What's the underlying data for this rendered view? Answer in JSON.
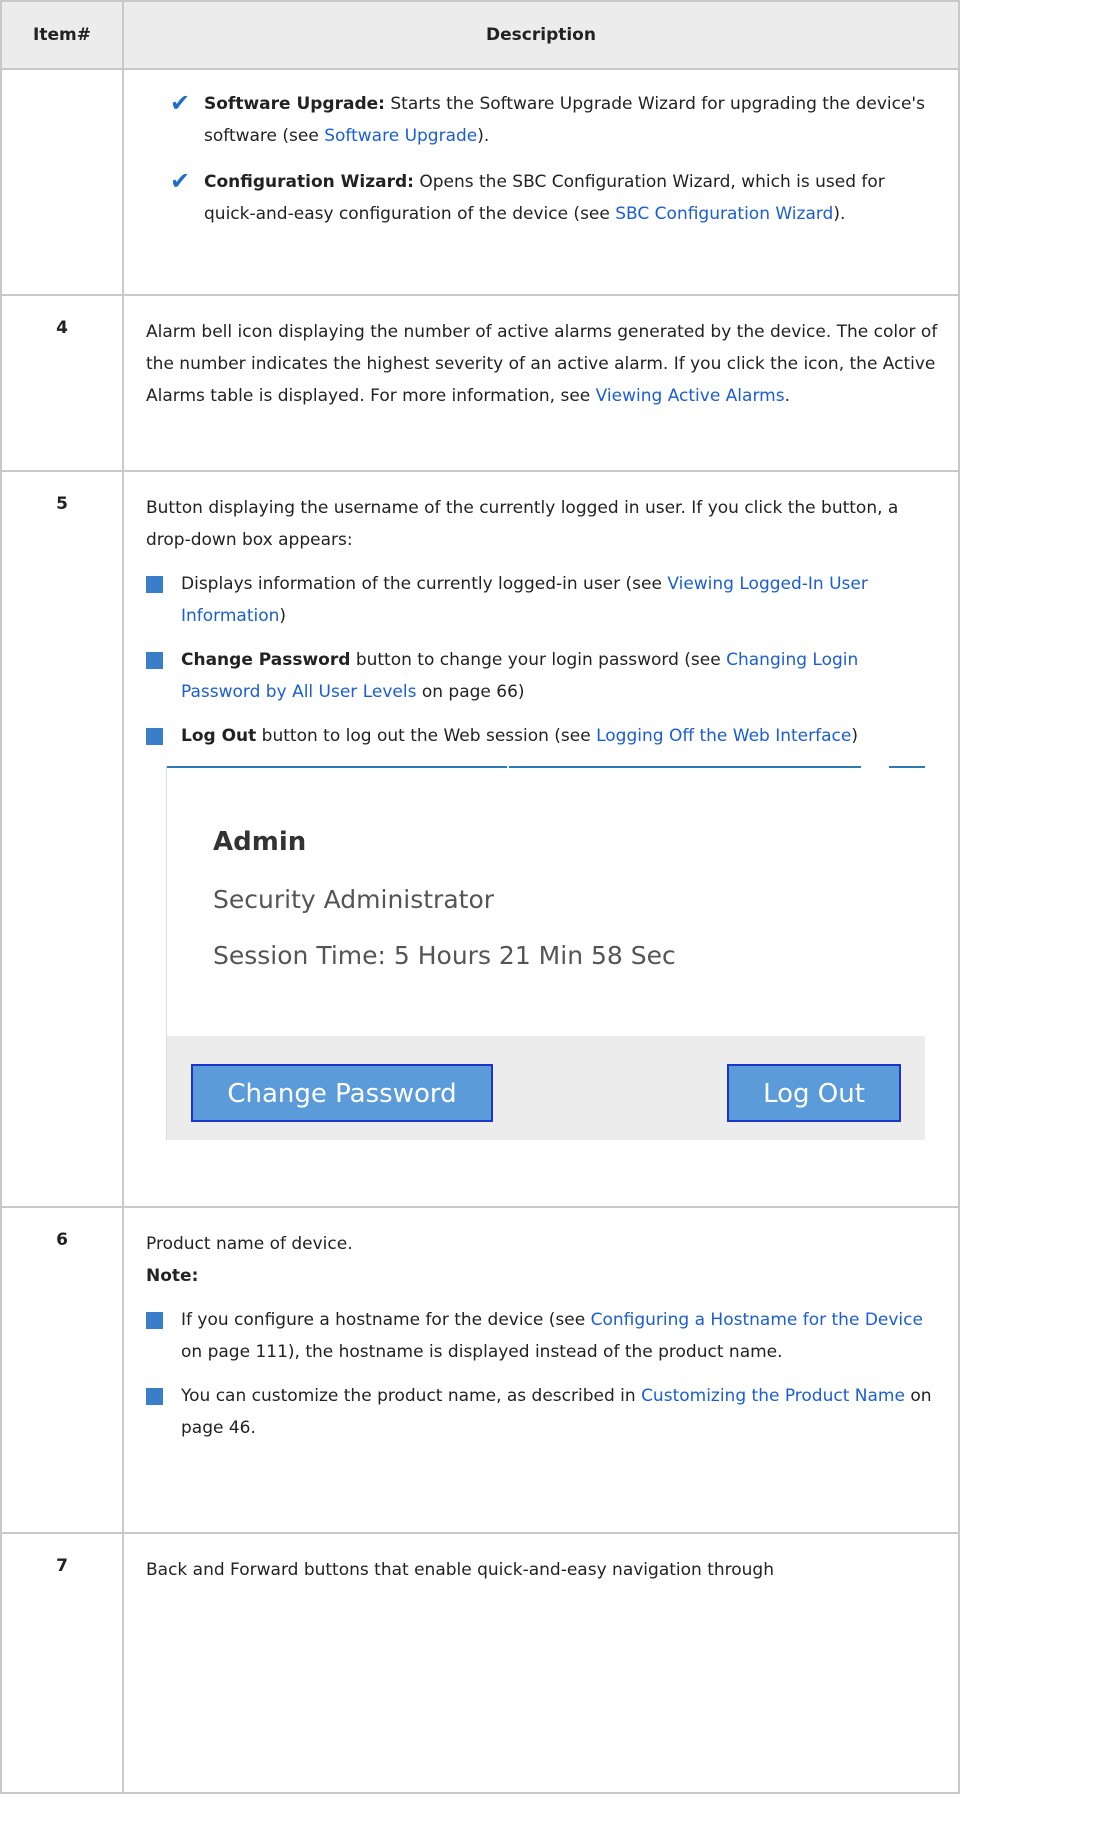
{
  "table": {
    "header": {
      "item": "Item#",
      "description": "Description"
    },
    "row_top": {
      "software_upgrade": {
        "bold": "Software Upgrade:",
        "text1": " Starts the Software Upgrade Wizard for upgrading the device's software (see ",
        "link": "Software Upgrade",
        "text2": ")."
      },
      "config_wizard": {
        "bold": "Configuration Wizard:",
        "text1": " Opens the SBC Configuration Wizard, which is used for quick-and-easy configuration of the device (see ",
        "link": "SBC Configuration Wizard",
        "text2": ")."
      }
    },
    "row4": {
      "number": "4",
      "text": "Alarm bell icon displaying the number of active alarms generated by the device. The color of the number indicates the highest severity of an active alarm. If you click the icon, the Active Alarms table is displayed. For more information, see ",
      "link": "Viewing Active Alarms",
      "text_end": "."
    },
    "row5": {
      "number": "5",
      "intro": "Button displaying the username of the currently logged in user. If you click the button, a drop-down box appears:",
      "b1": {
        "text1": "Displays information of the currently logged-in user (see ",
        "link": "Viewing Logged-In User Information",
        "text2": ")"
      },
      "b2": {
        "bold": "Change Password",
        "text1": " button to change your login password (see ",
        "link": "Changing Login Password by All User Levels",
        "text2": " on page 66)"
      },
      "b3": {
        "bold": "Log Out",
        "text1": " button to log out the Web session (see ",
        "link": "Logging Off the Web Interface",
        "text2": ")"
      },
      "screenshot": {
        "username": "Admin",
        "role": "Security Administrator",
        "session": "Session Time: 5 Hours 21 Min 58 Sec",
        "change_password_button": "Change Password",
        "log_out_button": "Log Out"
      }
    },
    "row6": {
      "number": "6",
      "text": "Product name of device.",
      "note": "Note:",
      "b1": {
        "text1": "If you configure a hostname for the device (see ",
        "link": "Configuring a Hostname for the Device",
        "text2": " on page 111), the hostname is displayed instead of the product name."
      },
      "b2": {
        "text1": "You can customize the product name, as described in ",
        "link": "Customizing the Product Name",
        "text2": " on page 46."
      }
    },
    "row7": {
      "number": "7",
      "text": "Back and Forward buttons that enable quick-and-easy navigation through"
    }
  },
  "colors": {
    "link": "#1a5dd6",
    "bullet": "#3a7dc9",
    "checkmark": "#1f6fc9",
    "button_fill": "#5b9bd9",
    "button_border": "#1b36c8"
  }
}
